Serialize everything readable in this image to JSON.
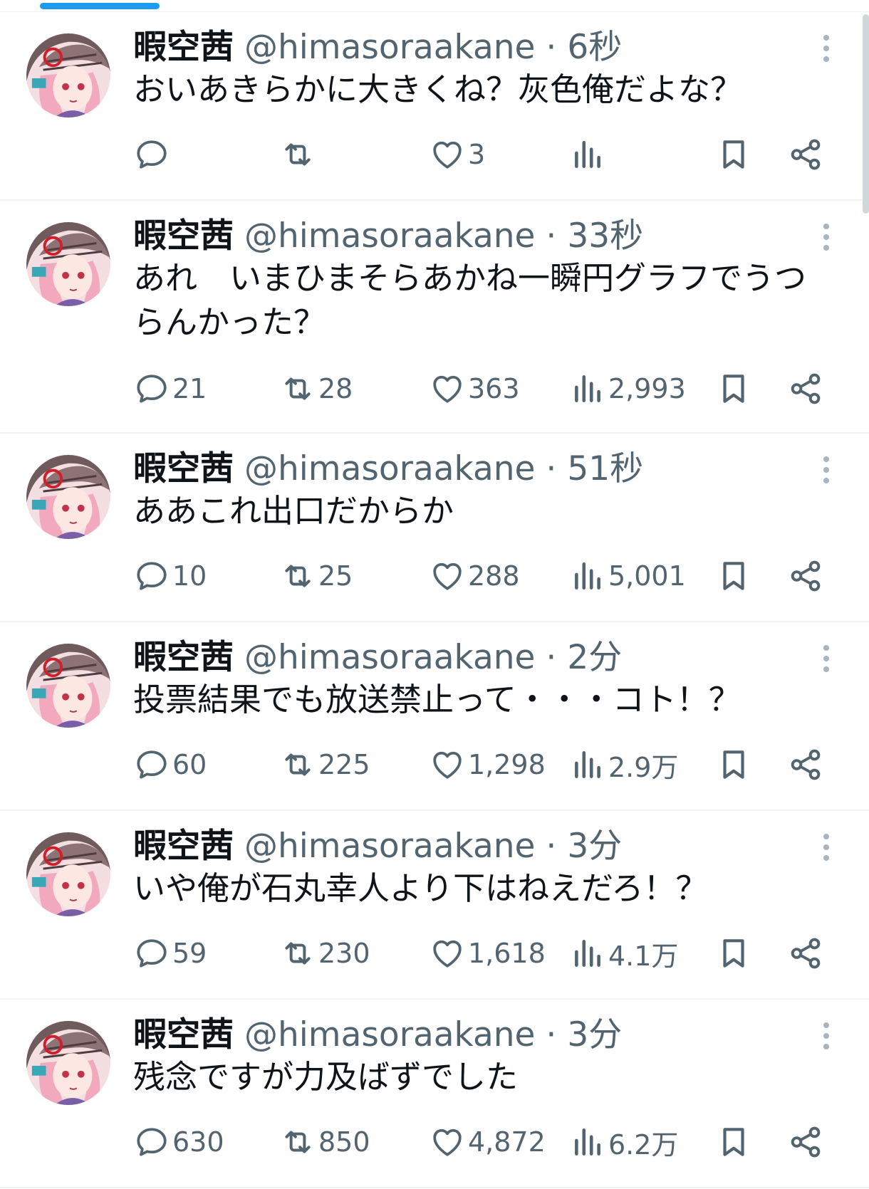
{
  "colors": {
    "accent": "#1d9bf0",
    "text_primary": "#0f1419",
    "text_secondary": "#536471",
    "divider": "#eff3f4"
  },
  "tweets": [
    {
      "name": "暇空茜",
      "handle": "@himasoraakane",
      "separator": "·",
      "time": "6秒",
      "text": "おいあきらかに大きくね？灰色俺だよな？",
      "replies": "",
      "retweets": "",
      "likes": "3",
      "views": ""
    },
    {
      "name": "暇空茜",
      "handle": "@himasoraakane",
      "separator": "·",
      "time": "33秒",
      "text": "あれ　いまひまそらあかね一瞬円グラフでうつらんかった？",
      "replies": "21",
      "retweets": "28",
      "likes": "363",
      "views": "2,993"
    },
    {
      "name": "暇空茜",
      "handle": "@himasoraakane",
      "separator": "·",
      "time": "51秒",
      "text": "ああこれ出口だからか",
      "replies": "10",
      "retweets": "25",
      "likes": "288",
      "views": "5,001"
    },
    {
      "name": "暇空茜",
      "handle": "@himasoraakane",
      "separator": "·",
      "time": "2分",
      "text": "投票結果でも放送禁止って・・・コト！？",
      "replies": "60",
      "retweets": "225",
      "likes": "1,298",
      "views": "2.9万"
    },
    {
      "name": "暇空茜",
      "handle": "@himasoraakane",
      "separator": "·",
      "time": "3分",
      "text": "いや俺が石丸幸人より下はねえだろ！？",
      "replies": "59",
      "retweets": "230",
      "likes": "1,618",
      "views": "4.1万"
    },
    {
      "name": "暇空茜",
      "handle": "@himasoraakane",
      "separator": "·",
      "time": "3分",
      "text": "残念ですが力及ばずでした",
      "replies": "630",
      "retweets": "850",
      "likes": "4,872",
      "views": "6.2万"
    }
  ]
}
